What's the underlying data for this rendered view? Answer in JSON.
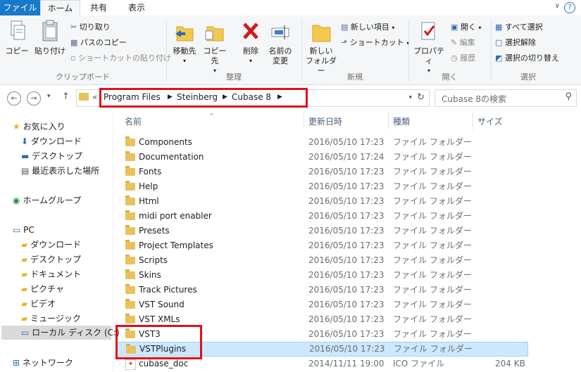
{
  "tabs": [
    "ファイル",
    "ホーム",
    "共有",
    "表示"
  ],
  "ribbon": {
    "clipboard": {
      "copy": "コピー",
      "paste": "貼り付け",
      "cut": "切り取り",
      "copy_path": "パスのコピー",
      "paste_shortcut": "ショートカットの貼り付け",
      "label": "クリップボード"
    },
    "organize": {
      "move_to": "移動先",
      "copy_to": "コピー先",
      "delete": "削除",
      "rename_1": "名前の",
      "rename_2": "変更",
      "label": "整理"
    },
    "new": {
      "new_folder_1": "新しい",
      "new_folder_2": "フォルダー",
      "new_item": "新しい項目",
      "shortcut": "ショートカット",
      "label": "新規"
    },
    "open": {
      "properties": "プロパティ",
      "open": "開く",
      "edit": "編集",
      "history": "履歴",
      "label": "開く"
    },
    "select": {
      "select_all": "すべて選択",
      "select_none": "選択解除",
      "invert": "選択の切り替え",
      "label": "選択"
    }
  },
  "address": {
    "overflow": "«",
    "crumbs": [
      "Program Files",
      "Steinberg",
      "Cubase 8"
    ],
    "search_placeholder": "Cubase 8の検索",
    "highlight_color": "#e0111b"
  },
  "navpane": {
    "quick_access": "お気に入り",
    "qa_items": [
      "ダウンロード",
      "デスクトップ",
      "最近表示した場所"
    ],
    "homegroup": "ホームグループ",
    "pc": "PC",
    "pc_items": [
      "ダウンロード",
      "デスクトップ",
      "ドキュメント",
      "ピクチャ",
      "ビデオ",
      "ミュージック",
      "ローカル ディスク (C:)"
    ],
    "network": "ネットワーク"
  },
  "columns": [
    "名前",
    "更新日時",
    "種類",
    "サイズ"
  ],
  "files": [
    {
      "name": "Components",
      "date": "2016/05/10 17:23",
      "type": "ファイル フォルダー",
      "size": ""
    },
    {
      "name": "Documentation",
      "date": "2016/05/10 17:24",
      "type": "ファイル フォルダー",
      "size": ""
    },
    {
      "name": "Fonts",
      "date": "2016/05/10 17:23",
      "type": "ファイル フォルダー",
      "size": ""
    },
    {
      "name": "Help",
      "date": "2016/05/10 17:23",
      "type": "ファイル フォルダー",
      "size": ""
    },
    {
      "name": "Html",
      "date": "2016/05/10 17:23",
      "type": "ファイル フォルダー",
      "size": ""
    },
    {
      "name": "midi port enabler",
      "date": "2016/05/10 17:23",
      "type": "ファイル フォルダー",
      "size": ""
    },
    {
      "name": "Presets",
      "date": "2016/05/10 17:23",
      "type": "ファイル フォルダー",
      "size": ""
    },
    {
      "name": "Project Templates",
      "date": "2016/05/10 17:23",
      "type": "ファイル フォルダー",
      "size": ""
    },
    {
      "name": "Scripts",
      "date": "2016/05/10 17:23",
      "type": "ファイル フォルダー",
      "size": ""
    },
    {
      "name": "Skins",
      "date": "2016/05/10 17:23",
      "type": "ファイル フォルダー",
      "size": ""
    },
    {
      "name": "Track Pictures",
      "date": "2016/05/10 17:23",
      "type": "ファイル フォルダー",
      "size": ""
    },
    {
      "name": "VST Sound",
      "date": "2016/05/10 17:23",
      "type": "ファイル フォルダー",
      "size": ""
    },
    {
      "name": "VST XMLs",
      "date": "2016/05/10 17:23",
      "type": "ファイル フォルダー",
      "size": ""
    },
    {
      "name": "VST3",
      "date": "2016/05/10 17:23",
      "type": "ファイル フォルダー",
      "size": ""
    },
    {
      "name": "VSTPlugins",
      "date": "2016/05/10 17:23",
      "type": "ファイル フォルダー",
      "size": ""
    },
    {
      "name": "cubase_doc",
      "date": "2014/11/11 19:00",
      "type": "ICO ファイル",
      "size": "204 KB"
    }
  ]
}
